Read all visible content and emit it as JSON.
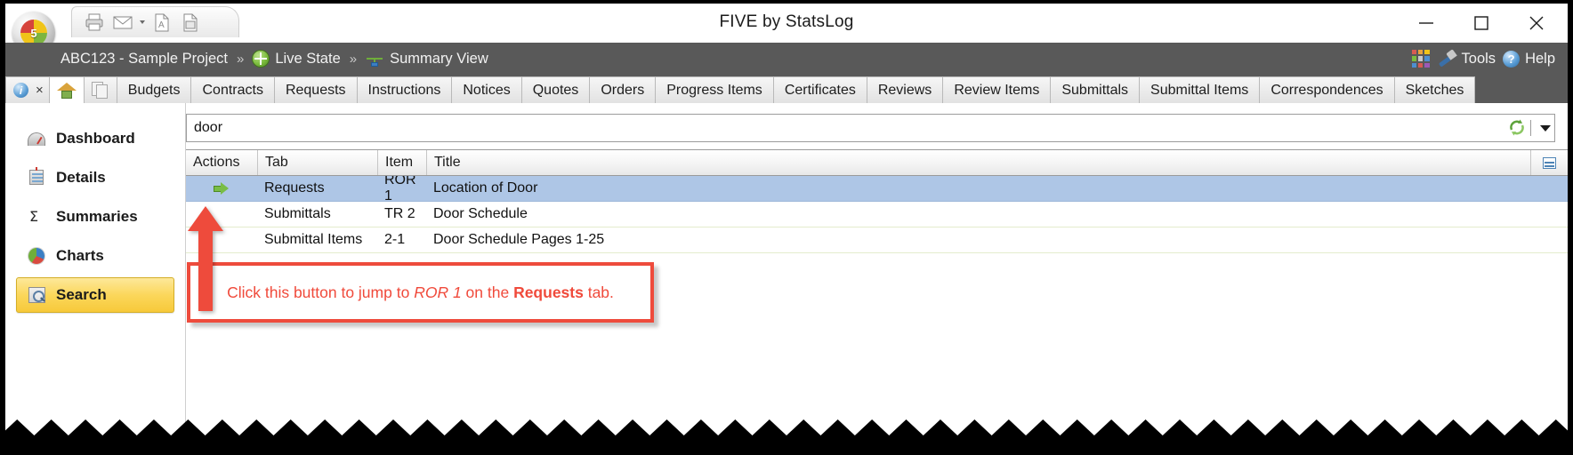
{
  "window": {
    "title": "FIVE by StatsLog",
    "minimize_label": "Minimize",
    "maximize_label": "Maximize",
    "close_label": "Close",
    "orb_number": "5"
  },
  "quick_access": {
    "buttons": [
      {
        "name": "print-icon",
        "label": "Print"
      },
      {
        "name": "email-icon",
        "label": "Email"
      },
      {
        "name": "pdf-icon",
        "label": "Export PDF"
      },
      {
        "name": "excel-icon",
        "label": "Export Excel"
      }
    ]
  },
  "breadcrumb": {
    "project": "ABC123 - Sample Project",
    "separator": "»",
    "state": "Live State",
    "view": "Summary View"
  },
  "header_right": {
    "tools_label": "Tools",
    "help_label": "Help",
    "help_glyph": "?"
  },
  "tabs": {
    "info_glyph": "i",
    "close_glyph": "×",
    "items": [
      {
        "label": "Budgets"
      },
      {
        "label": "Contracts"
      },
      {
        "label": "Requests"
      },
      {
        "label": "Instructions"
      },
      {
        "label": "Notices"
      },
      {
        "label": "Quotes"
      },
      {
        "label": "Orders"
      },
      {
        "label": "Progress Items"
      },
      {
        "label": "Certificates"
      },
      {
        "label": "Reviews"
      },
      {
        "label": "Review Items"
      },
      {
        "label": "Submittals"
      },
      {
        "label": "Submittal Items"
      },
      {
        "label": "Correspondences"
      },
      {
        "label": "Sketches"
      }
    ]
  },
  "sidebar": {
    "items": [
      {
        "label": "Dashboard",
        "icon": "dashboard-icon",
        "selected": false
      },
      {
        "label": "Details",
        "icon": "details-icon",
        "selected": false
      },
      {
        "label": "Summaries",
        "icon": "sigma-icon",
        "selected": false
      },
      {
        "label": "Charts",
        "icon": "pie-chart-icon",
        "selected": false
      },
      {
        "label": "Search",
        "icon": "search-icon",
        "selected": true
      }
    ]
  },
  "search": {
    "value": "door",
    "placeholder": "",
    "refresh_label": "Refresh",
    "dropdown_label": "Options"
  },
  "table": {
    "columns": [
      "Actions",
      "Tab",
      "Item",
      "Title"
    ],
    "rows": [
      {
        "action": "go-arrow",
        "tab": "Requests",
        "item": "ROR 1",
        "title": "Location of Door",
        "selected": true
      },
      {
        "action": "",
        "tab": "Submittals",
        "item": "TR 2",
        "title": "Door Schedule",
        "selected": false
      },
      {
        "action": "",
        "tab": "Submittal Items",
        "item": "2-1",
        "title": "Door Schedule Pages 1-25",
        "selected": false
      }
    ]
  },
  "annotation": {
    "text_prefix": "Click this button to jump to ",
    "text_italic": "ROR 1",
    "text_middle": " on the ",
    "text_bold": "Requests",
    "text_suffix": " tab.",
    "color": "#f04a3b"
  },
  "colors": {
    "accent_red": "#ee4b3c",
    "selection_blue": "#aec6e6",
    "sidebar_selected": "#fbd75b",
    "chrome_gray": "#595959"
  }
}
